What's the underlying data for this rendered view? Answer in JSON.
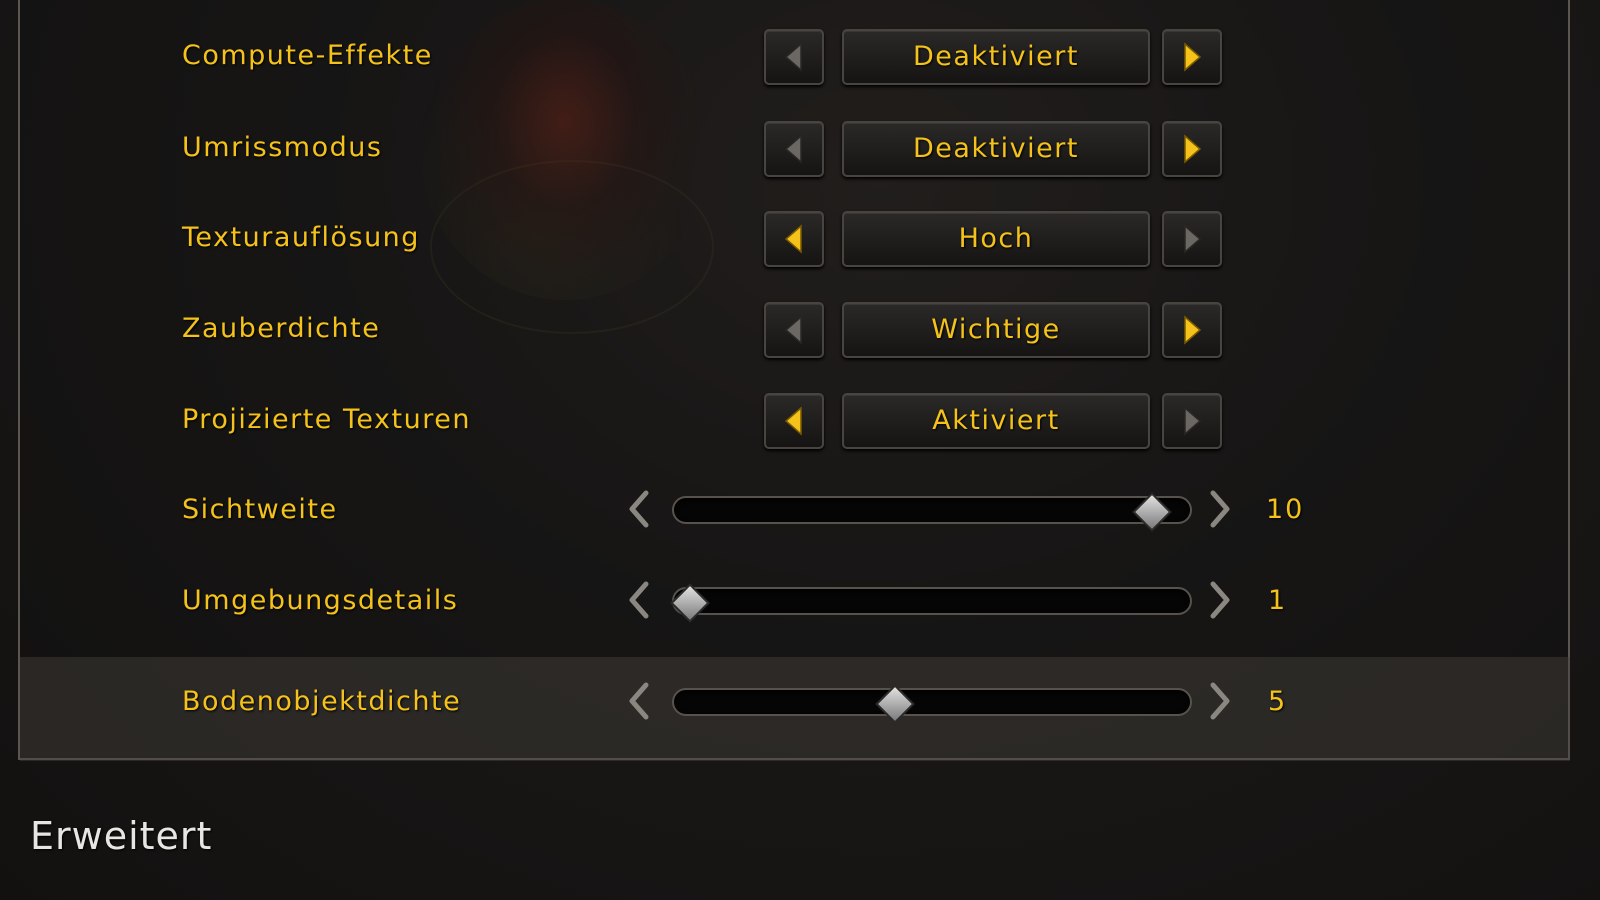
{
  "colors": {
    "label_text": "#f4c21a",
    "arrow_active": "#f4c21a",
    "arrow_inactive": "#6b6763",
    "button_bg": "#1f1d1b",
    "panel_border": "#5b5650",
    "section_title": "#e8e6e2"
  },
  "icons": {
    "arrow_left": "triangle-left-icon",
    "arrow_right": "triangle-right-icon",
    "slider_left": "chevron-left-icon",
    "slider_right": "chevron-right-icon",
    "slider_thumb": "diamond-thumb"
  },
  "dropdown_settings": [
    {
      "label": "Compute-Effekte",
      "value": "Deaktiviert",
      "left_active": false,
      "right_active": true
    },
    {
      "label": "Umrissmodus",
      "value": "Deaktiviert",
      "left_active": false,
      "right_active": true
    },
    {
      "label": "Texturauflösung",
      "value": "Hoch",
      "left_active": true,
      "right_active": false
    },
    {
      "label": "Zauberdichte",
      "value": "Wichtige",
      "left_active": false,
      "right_active": true
    },
    {
      "label": "Projizierte Texturen",
      "value": "Aktiviert",
      "left_active": true,
      "right_active": false
    }
  ],
  "slider_settings": [
    {
      "label": "Sichtweite",
      "value": "10",
      "min": 1,
      "max": 10,
      "level": 10
    },
    {
      "label": "Umgebungsdetails",
      "value": "1",
      "min": 1,
      "max": 10,
      "level": 1
    },
    {
      "label": "Bodenobjektdichte",
      "value": "5",
      "min": 1,
      "max": 10,
      "level": 5
    }
  ],
  "section": {
    "title": "Erweitert"
  }
}
